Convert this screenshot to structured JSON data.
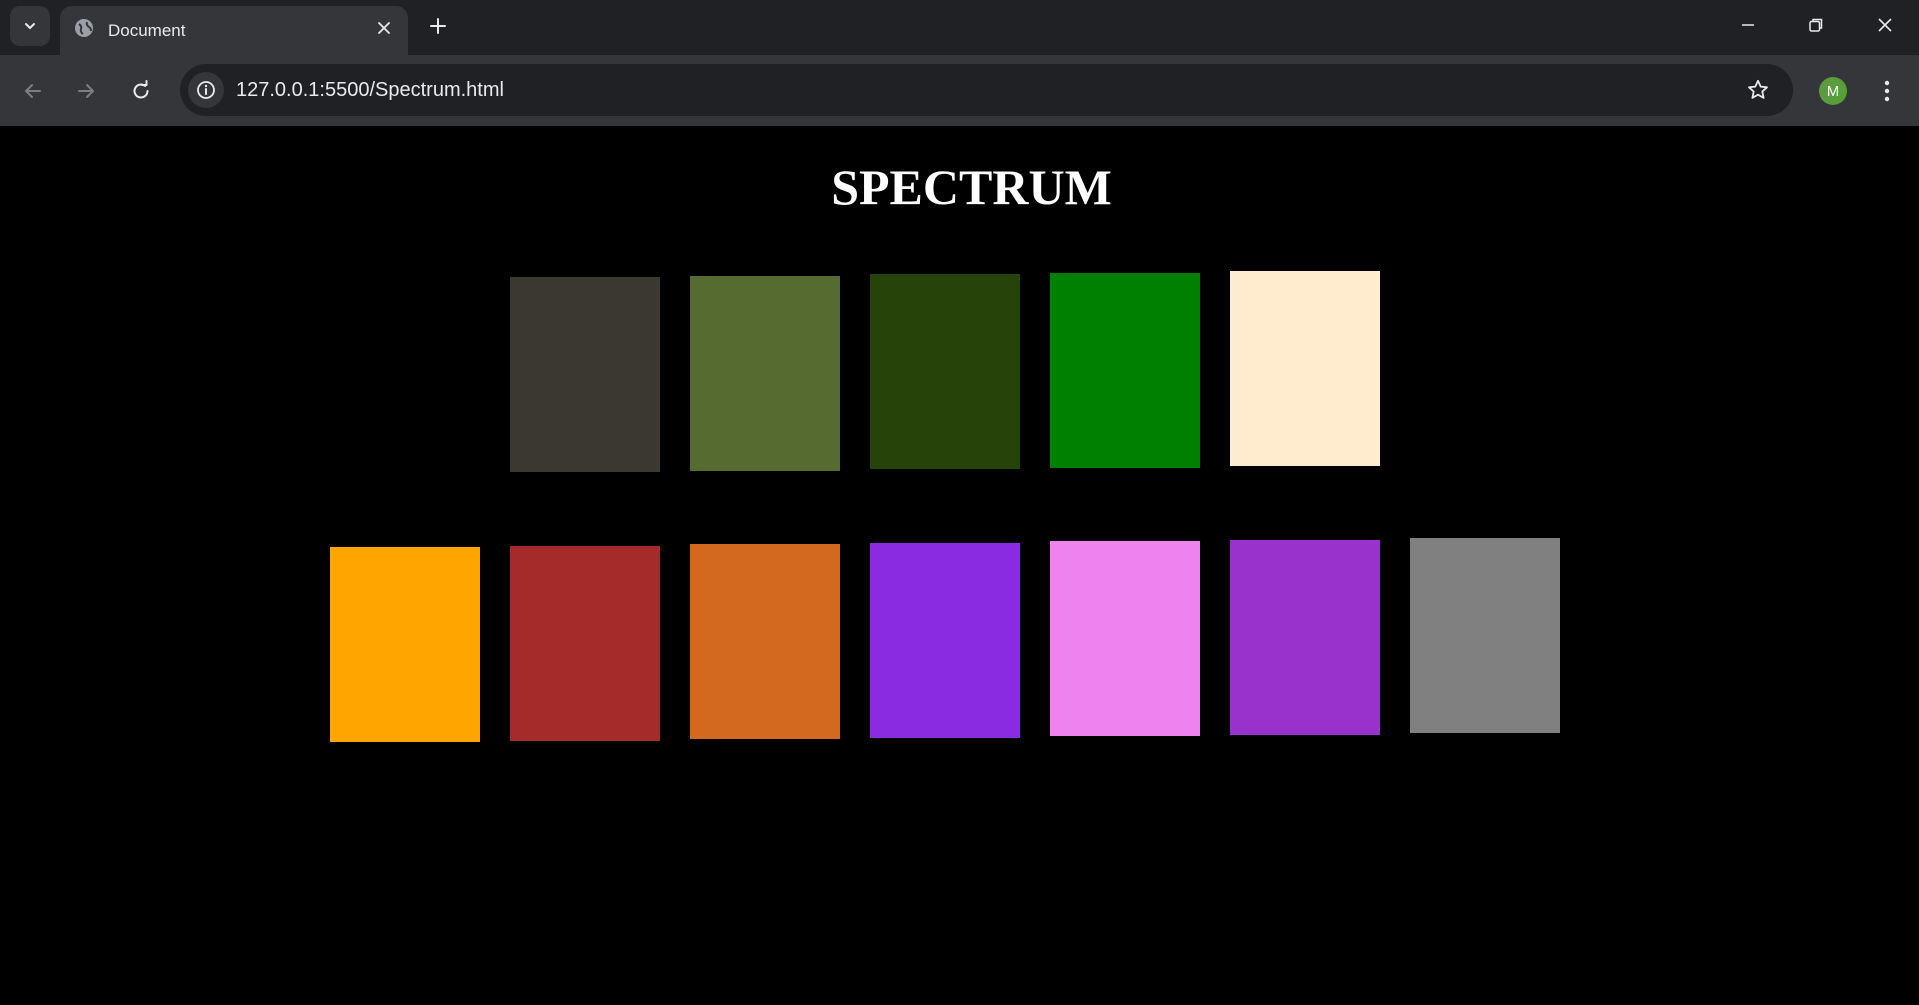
{
  "browser": {
    "tab_title": "Document",
    "url": "127.0.0.1:5500/Spectrum.html",
    "profile_initial": "M",
    "profile_color": "#5a9e3c"
  },
  "page": {
    "title": "SPECTRUM",
    "background": "#000000",
    "row1_colors": [
      "#3b3731",
      "#556b2f",
      "#264409",
      "#008000",
      "#ffebcd"
    ],
    "row2_colors": [
      "#ffa500",
      "#a52a2a",
      "#d2691e",
      "#8a2be2",
      "#ee82ee",
      "#9932cc",
      "#808080"
    ]
  }
}
